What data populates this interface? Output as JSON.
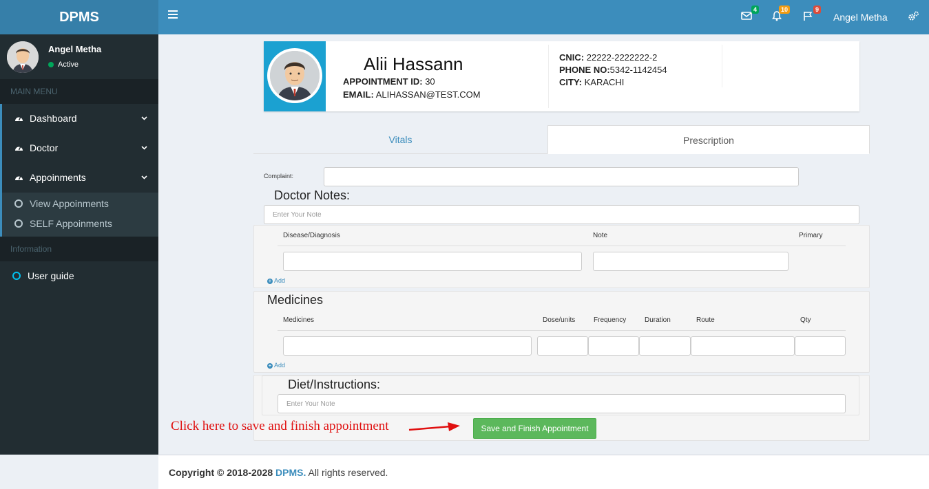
{
  "app": {
    "logo": "DPMS"
  },
  "header": {
    "mail_badge": "4",
    "bell_badge": "10",
    "flag_badge": "9",
    "user_name": "Angel Metha",
    "colors": {
      "mail_badge": "#00a65a",
      "bell_badge": "#f39c12",
      "flag_badge": "#dd4b39"
    }
  },
  "sidebar": {
    "user_name": "Angel Metha",
    "status": "Active",
    "main_menu_header": "MAIN MENU",
    "items": [
      {
        "label": "Dashboard",
        "icon": "dashboard-icon"
      },
      {
        "label": "Doctor",
        "icon": "dashboard-icon"
      },
      {
        "label": "Appoinments",
        "icon": "dashboard-icon"
      }
    ],
    "subitems": [
      {
        "label": "View Appoinments"
      },
      {
        "label": "SELF Appoinments"
      }
    ],
    "info_header": "Information",
    "user_guide": "User guide"
  },
  "patient": {
    "name": "Alii Hassann",
    "appointment_id_label": "APPOINTMENT ID:",
    "appointment_id": "30",
    "email_label": "EMAIL:",
    "email": "ALIHASSAN@TEST.COM",
    "cnic_label": "CNIC:",
    "cnic": "22222-2222222-2",
    "phone_label": "PHONE NO:",
    "phone": "5342-1142454",
    "city_label": "CITY:",
    "city": "KARACHI"
  },
  "tabs": {
    "vitals": "Vitals",
    "prescription": "Prescription"
  },
  "form": {
    "complaint_label": "Complaint:",
    "doctor_notes_title": "Doctor Notes:",
    "doctor_notes_placeholder": "Enter Your Note",
    "diagnosis_cols": [
      "Disease/Diagnosis",
      "Note",
      "Primary"
    ],
    "add_label": "Add",
    "medicines_title": "Medicines",
    "medicine_cols": [
      "Medicines",
      "Dose/units",
      "Frequency",
      "Duration",
      "Route",
      "Qty"
    ],
    "diet_title": "Diet/Instructions:",
    "diet_placeholder": "Enter Your Note"
  },
  "annotation": "Click here to save and finish appointment",
  "save_button": "Save and Finish Appointment",
  "footer": {
    "copyright": "Copyright © 2018-2028",
    "brand": "DPMS.",
    "rights": "All rights reserved."
  }
}
